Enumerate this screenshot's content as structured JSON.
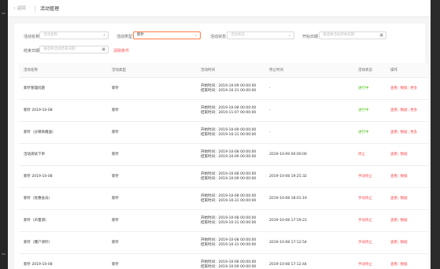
{
  "header": {
    "back_label": "返回",
    "title": "活动管理"
  },
  "filters": {
    "name_label": "活动名称",
    "name_placeholder": "活动名称",
    "type_label": "活动类型",
    "type_value": "新针",
    "status_label": "活动状态",
    "status_placeholder": "活动状态",
    "start_label": "开始日期",
    "start_placeholder": "请选择活动开始日期",
    "end_label": "结束日期",
    "end_placeholder": "请选择活动结束日期",
    "clear_label": "清除条件"
  },
  "table": {
    "columns": [
      "活动名称",
      "活动类型",
      "活动时间",
      "停止时间",
      "活动状态",
      "操作"
    ],
    "start_prefix": "开始时间：",
    "end_prefix": "结束时间：",
    "rows": [
      {
        "name": "新针管理问题",
        "type": "新针",
        "start": "2019-10-09 00:00:00",
        "end": "2019-10-31 00:00:00",
        "stop": "-",
        "status": "进行中",
        "status_kind": "ok",
        "ops": [
          "查看",
          "数据",
          "更多"
        ]
      },
      {
        "name": "新针 2019-10-08",
        "type": "新针",
        "start": "2019-10-08 00:00:00",
        "end": "2019-11-07 00:00:00",
        "stop": "-",
        "status": "进行中",
        "status_kind": "ok",
        "ops": [
          "查看",
          "数据",
          "更多"
        ]
      },
      {
        "name": "新针（分销商赠送）",
        "type": "新针",
        "start": "2019-10-09 00:00:00",
        "end": "2019-10-31 00:00:00",
        "stop": "-",
        "status": "进行中",
        "status_kind": "ok",
        "ops": [
          "查看",
          "数据",
          "更多"
        ]
      },
      {
        "name": "活动测试下单",
        "type": "新针",
        "start": "2019-10-08 00:00:00",
        "end": "2019-10-09 00:00:00",
        "stop": "2019-10-09 00:00:00",
        "status": "停止",
        "status_kind": "warn",
        "ops": [
          "查看",
          "数据"
        ]
      },
      {
        "name": "新针 2019-10-08",
        "type": "新针",
        "start": "2019-10-08 00:00:00",
        "end": "2019-10-09 00:00:00",
        "stop": "2019-10-08 19:25:32",
        "status": "手动停止",
        "status_kind": "warn",
        "ops": [
          "查看",
          "数据"
        ]
      },
      {
        "name": "新针（优惠会员）",
        "type": "新针",
        "start": "2019-10-08 00:00:00",
        "end": "2019-10-31 00:00:00",
        "stop": "2019-10-08 18:01:19",
        "status": "手动停止",
        "status_kind": "warn",
        "ops": [
          "查看",
          "数据"
        ]
      },
      {
        "name": "新针（声量测）",
        "type": "新针",
        "start": "2019-10-08 00:00:00",
        "end": "2019-10-31 00:00:00",
        "stop": "2019-10-08 17:59:23",
        "status": "手动停止",
        "status_kind": "warn",
        "ops": [
          "查看",
          "数据"
        ]
      },
      {
        "name": "新针（爆户领针）",
        "type": "新针",
        "start": "2019-10-08 00:00:00",
        "end": "2019-10-31 00:00:00",
        "stop": "2019-10-08 17:12:54",
        "status": "手动停止",
        "status_kind": "warn",
        "ops": [
          "查看",
          "数据"
        ]
      },
      {
        "name": "新针 2019-10-08",
        "type": "新针",
        "start": "2019-10-08 00:00:00",
        "end": "2019-10-09 00:00:00",
        "stop": "2019-10-08 17:12:44",
        "status": "手动停止",
        "status_kind": "warn",
        "ops": [
          "查看",
          "数据"
        ]
      }
    ]
  },
  "colors": {
    "accent": "#ff7a45",
    "ok": "#52c41a",
    "warn": "#ff4d4f"
  }
}
